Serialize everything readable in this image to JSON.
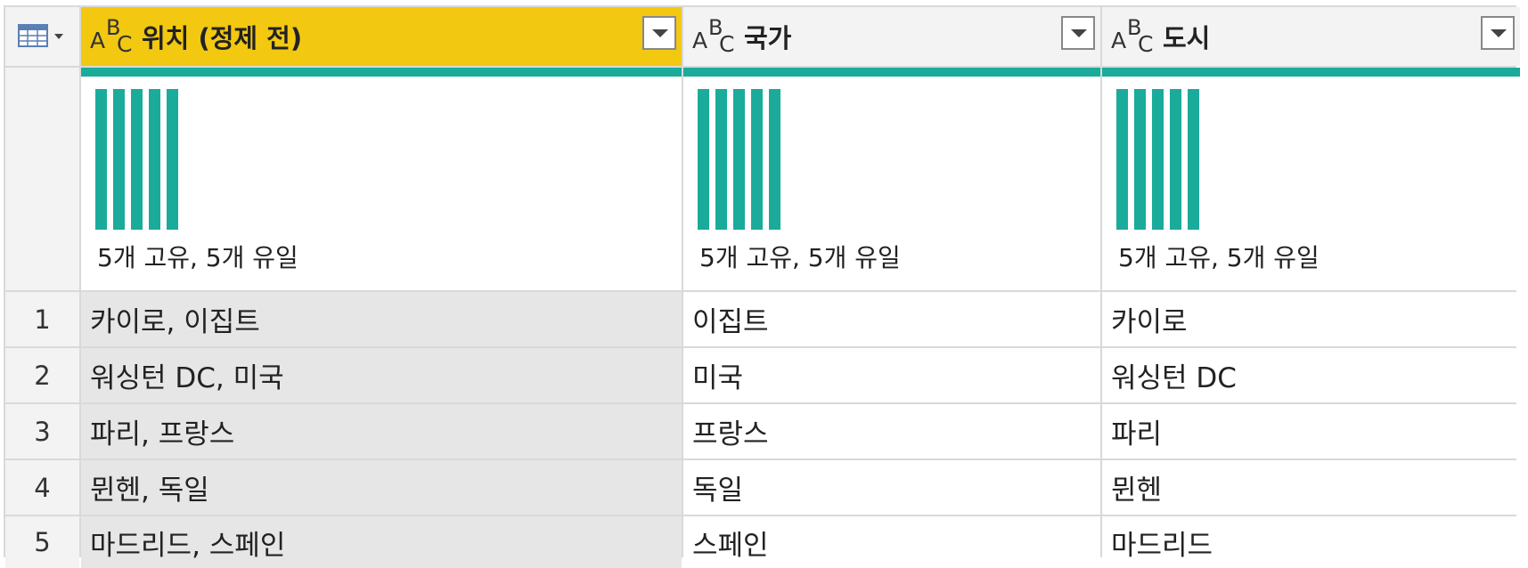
{
  "columns": [
    {
      "name": "위치 (정제 전)",
      "type_letters": [
        "A",
        "B",
        "C"
      ],
      "profile": "5개 고유, 5개 유일",
      "selected": true
    },
    {
      "name": "국가",
      "type_letters": [
        "A",
        "B",
        "C"
      ],
      "profile": "5개 고유, 5개 유일",
      "selected": false
    },
    {
      "name": "도시",
      "type_letters": [
        "A",
        "B",
        "C"
      ],
      "profile": "5개 고유, 5개 유일",
      "selected": false
    }
  ],
  "colors": {
    "selected_header": "#f2c811",
    "quality_bar": "#1aab9b",
    "selected_column_bg": "#e6e6e6"
  },
  "rows": [
    {
      "num": "1",
      "cells": [
        "카이로, 이집트",
        "이집트",
        "카이로"
      ]
    },
    {
      "num": "2",
      "cells": [
        "워싱턴 DC, 미국",
        "미국",
        "워싱턴 DC"
      ]
    },
    {
      "num": "3",
      "cells": [
        "파리, 프랑스",
        "프랑스",
        "파리"
      ]
    },
    {
      "num": "4",
      "cells": [
        "뮌헨, 독일",
        "독일",
        "뮌헨"
      ]
    },
    {
      "num": "5",
      "cells": [
        "마드리드, 스페인",
        "스페인",
        "마드리드"
      ]
    }
  ],
  "icons": {
    "table_menu": "table-icon",
    "column_type": "text-type-icon",
    "column_filter": "chevron-down-icon"
  }
}
